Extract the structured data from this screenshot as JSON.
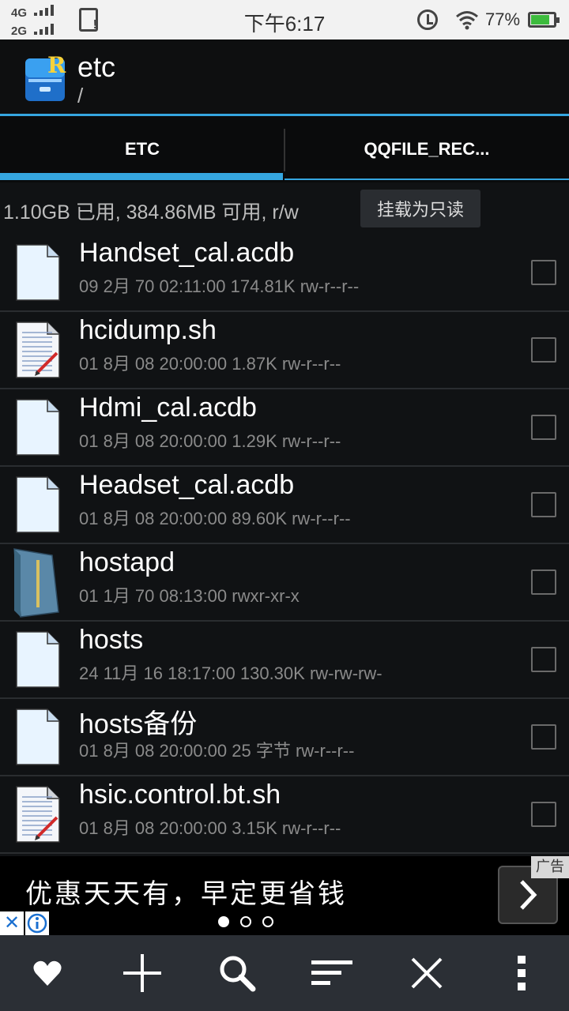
{
  "status_bar": {
    "signal1": "4G",
    "signal2": "2G",
    "time": "下午6:17",
    "battery": "77%"
  },
  "app": {
    "title": "etc",
    "path": "/"
  },
  "tabs": [
    {
      "label": "ETC",
      "active": true
    },
    {
      "label": "QQFILE_REC...",
      "active": false
    }
  ],
  "storage": {
    "info": "1.10GB 已用, 384.86MB 可用, r/w",
    "mount_button": "挂载为只读"
  },
  "files": [
    {
      "name": "Handset_cal.acdb",
      "meta": "09 2月 70 02:11:00  174.81K  rw-r--r--",
      "icon": "file-icon"
    },
    {
      "name": "hcidump.sh",
      "meta": "01 8月 08 20:00:00  1.87K  rw-r--r--",
      "icon": "script-icon"
    },
    {
      "name": "Hdmi_cal.acdb",
      "meta": "01 8月 08 20:00:00  1.29K  rw-r--r--",
      "icon": "file-icon"
    },
    {
      "name": "Headset_cal.acdb",
      "meta": "01 8月 08 20:00:00  89.60K  rw-r--r--",
      "icon": "file-icon"
    },
    {
      "name": "hostapd",
      "meta": "01 1月 70 08:13:00    rwxr-xr-x",
      "icon": "folder-icon"
    },
    {
      "name": "hosts",
      "meta": "24 11月 16 18:17:00  130.30K  rw-rw-rw-",
      "icon": "file-icon"
    },
    {
      "name": "hosts备份",
      "meta": "01 8月 08 20:00:00  25 字节  rw-r--r--",
      "icon": "file-icon"
    },
    {
      "name": "hsic.control.bt.sh",
      "meta": "01 8月 08 20:00:00  3.15K  rw-r--r--",
      "icon": "script-icon"
    }
  ],
  "ad": {
    "text": "优惠天天有，早定更省钱",
    "tag": "广告",
    "close": "✕"
  },
  "colors": {
    "accent": "#35a6e0",
    "background": "#101214",
    "toolbar": "#2b2f35"
  }
}
